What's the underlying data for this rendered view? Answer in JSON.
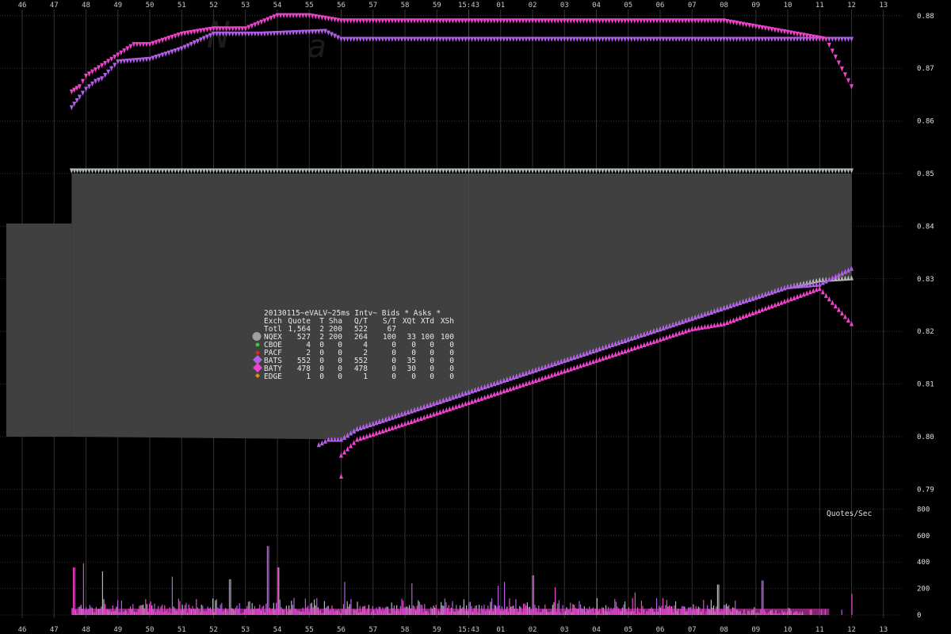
{
  "chart_data": {
    "type": "scatter",
    "x_tick_labels": [
      "46",
      "47",
      "48",
      "49",
      "50",
      "51",
      "52",
      "53",
      "54",
      "55",
      "56",
      "57",
      "58",
      "59",
      "15:43",
      "01",
      "02",
      "03",
      "04",
      "05",
      "06",
      "07",
      "08",
      "09",
      "10",
      "11",
      "12",
      "13"
    ],
    "price_axis": {
      "ticks": [
        "0.88",
        "0.87",
        "0.86",
        "0.85",
        "0.84",
        "0.83",
        "0.82",
        "0.81",
        "0.80",
        "0.79"
      ],
      "ylim": [
        0.788,
        0.883
      ]
    },
    "rate_axis": {
      "label": "Quotes/Sec",
      "ticks": [
        "800",
        "600",
        "400",
        "200",
        "0"
      ],
      "ylim": [
        0,
        800
      ]
    },
    "nbbo_shading": [
      {
        "x_start": 45.5,
        "x_end": 47.55,
        "top": 0.8405,
        "bottom": 0.8
      },
      {
        "x_start": 47.55,
        "x_end": 72.0,
        "top": 0.85,
        "bottom": "bid"
      }
    ],
    "colors": {
      "background": "#000000",
      "nbbo_fill": "#404040",
      "nqex": "#b0b8b8",
      "cboe": "#33cc33",
      "pacf": "#dd2222",
      "bats": "#b45ee8",
      "baty": "#ee44cc",
      "edge": "#e09020",
      "grid": "#333333"
    },
    "series": [
      {
        "name": "NQEX",
        "side": "ask",
        "color": "#b0b8b8",
        "points": [
          [
            47.55,
            0.8505
          ],
          [
            48,
            0.8505
          ],
          [
            49,
            0.8505
          ],
          [
            50,
            0.8505
          ],
          [
            51,
            0.8505
          ],
          [
            52,
            0.8505
          ],
          [
            53,
            0.8505
          ],
          [
            54,
            0.8505
          ],
          [
            55,
            0.8505
          ],
          [
            56,
            0.8505
          ],
          [
            57,
            0.8505
          ],
          [
            58,
            0.8505
          ],
          [
            59,
            0.8505
          ],
          [
            60,
            0.8505
          ],
          [
            61,
            0.8505
          ],
          [
            62,
            0.8505
          ],
          [
            63,
            0.8505
          ],
          [
            64,
            0.8505
          ],
          [
            65,
            0.8505
          ],
          [
            66,
            0.8505
          ],
          [
            67,
            0.8505
          ],
          [
            68,
            0.8505
          ],
          [
            69,
            0.8505
          ],
          [
            70,
            0.8505
          ],
          [
            71,
            0.8505
          ],
          [
            72,
            0.8505
          ]
        ]
      },
      {
        "name": "NQEX",
        "side": "bid",
        "color": "#b0b8b8",
        "points": [
          [
            56,
            0.7995
          ],
          [
            56.5,
            0.8015
          ],
          [
            57,
            0.8025
          ],
          [
            58,
            0.8045
          ],
          [
            59,
            0.8065
          ],
          [
            60,
            0.8085
          ],
          [
            61,
            0.8105
          ],
          [
            62,
            0.8125
          ],
          [
            63,
            0.8145
          ],
          [
            64,
            0.8165
          ],
          [
            65,
            0.8185
          ],
          [
            66,
            0.8205
          ],
          [
            67,
            0.8225
          ],
          [
            68,
            0.8245
          ],
          [
            69,
            0.8265
          ],
          [
            70,
            0.8285
          ],
          [
            71,
            0.8298
          ],
          [
            72,
            0.8302
          ]
        ]
      },
      {
        "name": "BATS",
        "side": "ask",
        "color": "#b45ee8",
        "points": [
          [
            47.55,
            0.8625
          ],
          [
            47.8,
            0.8645
          ],
          [
            48,
            0.866
          ],
          [
            48.3,
            0.8675
          ],
          [
            48.5,
            0.868
          ],
          [
            49,
            0.8712
          ],
          [
            50,
            0.8717
          ],
          [
            51,
            0.8737
          ],
          [
            52,
            0.8765
          ],
          [
            53,
            0.8765
          ],
          [
            53.5,
            0.8765
          ],
          [
            55.5,
            0.877
          ],
          [
            56,
            0.8755
          ],
          [
            57,
            0.8755
          ],
          [
            58,
            0.8755
          ],
          [
            59,
            0.8755
          ],
          [
            60,
            0.8755
          ],
          [
            61,
            0.8755
          ],
          [
            62,
            0.8755
          ],
          [
            63,
            0.8755
          ],
          [
            64,
            0.8755
          ],
          [
            65,
            0.8755
          ],
          [
            66,
            0.8755
          ],
          [
            67,
            0.8755
          ],
          [
            68,
            0.8755
          ],
          [
            69,
            0.8755
          ],
          [
            70,
            0.8755
          ],
          [
            71.2,
            0.8755
          ],
          [
            72,
            0.8755
          ]
        ]
      },
      {
        "name": "BATS",
        "side": "bid",
        "color": "#b45ee8",
        "points": [
          [
            55.3,
            0.7985
          ],
          [
            55.6,
            0.7995
          ],
          [
            56,
            0.7995
          ],
          [
            56.5,
            0.8015
          ],
          [
            57,
            0.8025
          ],
          [
            58,
            0.8045
          ],
          [
            59,
            0.8065
          ],
          [
            60,
            0.8085
          ],
          [
            61,
            0.8105
          ],
          [
            62,
            0.8125
          ],
          [
            63,
            0.8145
          ],
          [
            64,
            0.8165
          ],
          [
            65,
            0.8185
          ],
          [
            66,
            0.8205
          ],
          [
            67,
            0.8225
          ],
          [
            68,
            0.8245
          ],
          [
            69,
            0.8265
          ],
          [
            70,
            0.8285
          ],
          [
            71,
            0.829
          ],
          [
            72,
            0.832
          ]
        ]
      },
      {
        "name": "BATY",
        "side": "ask",
        "color": "#ee44cc",
        "points": [
          [
            47.55,
            0.8655
          ],
          [
            47.8,
            0.8665
          ],
          [
            48,
            0.8685
          ],
          [
            48.5,
            0.8705
          ],
          [
            49,
            0.8725
          ],
          [
            49.5,
            0.8745
          ],
          [
            50,
            0.8745
          ],
          [
            51,
            0.8765
          ],
          [
            52,
            0.8775
          ],
          [
            53,
            0.8775
          ],
          [
            54,
            0.88
          ],
          [
            55,
            0.88
          ],
          [
            56,
            0.879
          ],
          [
            57,
            0.879
          ],
          [
            58,
            0.879
          ],
          [
            59,
            0.879
          ],
          [
            60,
            0.879
          ],
          [
            61,
            0.879
          ],
          [
            62,
            0.879
          ],
          [
            63,
            0.879
          ],
          [
            64,
            0.879
          ],
          [
            65,
            0.879
          ],
          [
            66,
            0.879
          ],
          [
            67,
            0.879
          ],
          [
            68,
            0.879
          ],
          [
            71.2,
            0.8755
          ],
          [
            72,
            0.8665
          ]
        ]
      },
      {
        "name": "BATY",
        "side": "bid",
        "color": "#ee44cc",
        "points": [
          [
            56,
            0.7925
          ],
          [
            56,
            0.7965
          ],
          [
            56.5,
            0.7995
          ],
          [
            57,
            0.8005
          ],
          [
            58,
            0.8025
          ],
          [
            59,
            0.8045
          ],
          [
            60,
            0.8065
          ],
          [
            61,
            0.8085
          ],
          [
            62,
            0.8105
          ],
          [
            63,
            0.8125
          ],
          [
            64,
            0.8145
          ],
          [
            65,
            0.8165
          ],
          [
            66,
            0.8185
          ],
          [
            67,
            0.8205
          ],
          [
            68,
            0.8215
          ],
          [
            71,
            0.8282
          ],
          [
            72,
            0.8215
          ]
        ]
      }
    ],
    "quote_rate": {
      "series": [
        {
          "name": "BATS",
          "color": "#b45ee8"
        },
        {
          "name": "BATY",
          "color": "#ee44cc"
        },
        {
          "name": "NQEX",
          "color": "#b0b8b8"
        }
      ],
      "peaks": [
        [
          47.6,
          360
        ],
        [
          47.9,
          390
        ],
        [
          48.5,
          330
        ],
        [
          50.7,
          290
        ],
        [
          52.5,
          270
        ],
        [
          53.7,
          520
        ],
        [
          54,
          360
        ],
        [
          56.1,
          250
        ],
        [
          58.2,
          240
        ],
        [
          60.9,
          220
        ],
        [
          61.1,
          250
        ],
        [
          62,
          300
        ],
        [
          62.7,
          210
        ],
        [
          65.2,
          170
        ],
        [
          67.8,
          230
        ],
        [
          69.2,
          260
        ],
        [
          72,
          160
        ]
      ]
    },
    "legend": {
      "title": "20130115~eVALV~25ms Intv~ Bids * Asks *",
      "header": [
        "Exch",
        "Quote",
        "T",
        "Sha",
        "Q/T",
        "S/T",
        "XQt",
        "XTd",
        "XSh"
      ],
      "rows": [
        {
          "exch": "Totl",
          "cells": [
            "1,564",
            "2",
            "200",
            "522",
            "67",
            "",
            "",
            ""
          ],
          "color": "",
          "marker": "none"
        },
        {
          "exch": "NQEX",
          "cells": [
            "527",
            "2",
            "200",
            "264",
            "100",
            "33",
            "100",
            "100"
          ],
          "color": "#a0a0a0",
          "marker": "octagon"
        },
        {
          "exch": "CBOE",
          "cells": [
            "4",
            "0",
            "0",
            "4",
            "0",
            "0",
            "0",
            "0"
          ],
          "color": "#33cc33",
          "marker": "dot"
        },
        {
          "exch": "PACF",
          "cells": [
            "2",
            "0",
            "0",
            "2",
            "0",
            "0",
            "0",
            "0"
          ],
          "color": "#dd2222",
          "marker": "dot"
        },
        {
          "exch": "BATS",
          "cells": [
            "552",
            "0",
            "0",
            "552",
            "0",
            "35",
            "0",
            "0"
          ],
          "color": "#b45ee8",
          "marker": "diamond"
        },
        {
          "exch": "BATY",
          "cells": [
            "478",
            "0",
            "0",
            "478",
            "0",
            "30",
            "0",
            "0"
          ],
          "color": "#ee44cc",
          "marker": "diamond"
        },
        {
          "exch": "EDGE",
          "cells": [
            "1",
            "0",
            "0",
            "1",
            "0",
            "0",
            "0",
            "0"
          ],
          "color": "#e09020",
          "marker": "diamond-small"
        }
      ]
    }
  }
}
